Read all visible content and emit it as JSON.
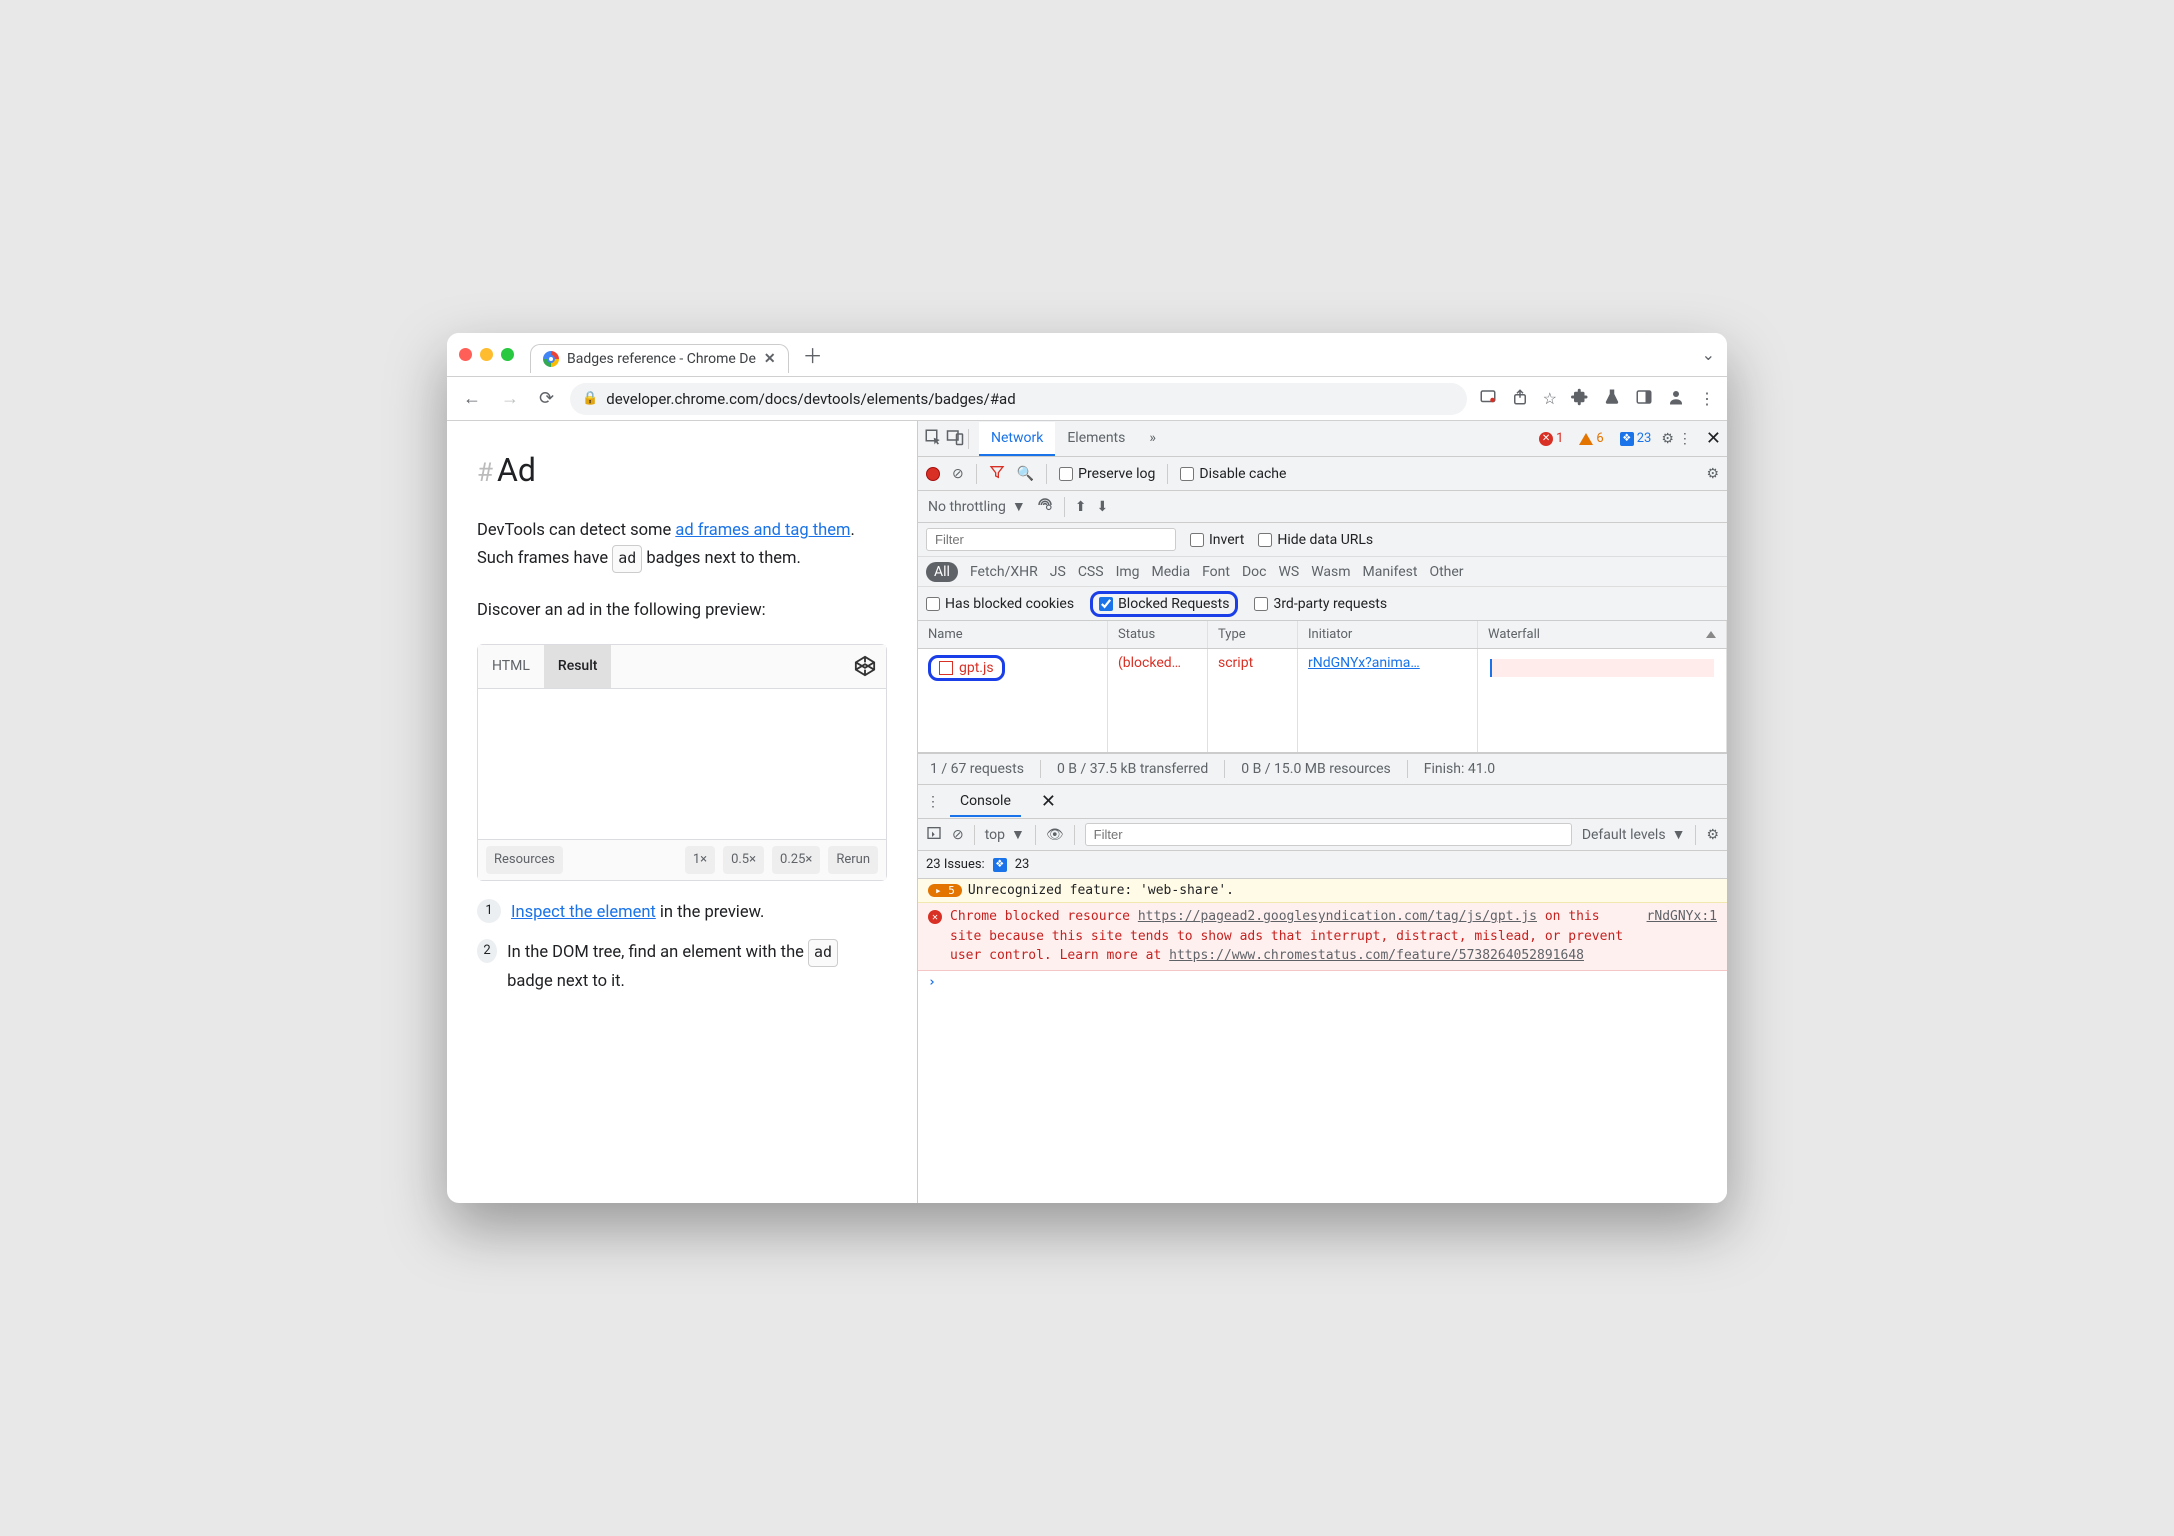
{
  "window": {
    "tab_title": "Badges reference - Chrome De",
    "url": "developer.chrome.com/docs/devtools/elements/badges/#ad"
  },
  "page": {
    "heading": "Ad",
    "intro_prefix": "DevTools can detect some ",
    "intro_link": "ad frames and tag them",
    "intro_suffix": ". Such frames have ",
    "intro_badge": "ad",
    "intro_end": " badges next to them.",
    "discover": "Discover an ad in the following preview:",
    "preview": {
      "tab_html": "HTML",
      "tab_result": "Result",
      "footer_resources": "Resources",
      "footer_1x": "1×",
      "footer_05x": "0.5×",
      "footer_025x": "0.25×",
      "footer_rerun": "Rerun"
    },
    "step1_link": "Inspect the element",
    "step1_rest": " in the preview.",
    "step2_prefix": "In the DOM tree, find an element with the ",
    "step2_badge": "ad",
    "step2_suffix": " badge next to it."
  },
  "devtools": {
    "tabs": {
      "network": "Network",
      "elements": "Elements"
    },
    "counts": {
      "errors": "1",
      "warnings": "6",
      "issues": "23"
    },
    "toolbar": {
      "preserve_log": "Preserve log",
      "disable_cache": "Disable cache",
      "no_throttling": "No throttling"
    },
    "filter": {
      "placeholder": "Filter",
      "invert": "Invert",
      "hide_urls": "Hide data URLs",
      "types": [
        "All",
        "Fetch/XHR",
        "JS",
        "CSS",
        "Img",
        "Media",
        "Font",
        "Doc",
        "WS",
        "Wasm",
        "Manifest",
        "Other"
      ],
      "has_blocked_cookies": "Has blocked cookies",
      "blocked_requests": "Blocked Requests",
      "third_party": "3rd-party requests"
    },
    "table": {
      "headers": {
        "name": "Name",
        "status": "Status",
        "type": "Type",
        "initiator": "Initiator",
        "waterfall": "Waterfall"
      },
      "row": {
        "name": "gpt.js",
        "status": "(blocked…",
        "type": "script",
        "initiator": "rNdGNYx?anima…"
      }
    },
    "status": {
      "requests": "1 / 67 requests",
      "transferred": "0 B / 37.5 kB transferred",
      "resources": "0 B / 15.0 MB resources",
      "finish": "Finish: 41.0"
    },
    "console": {
      "tab": "Console",
      "context": "top",
      "filter_placeholder": "Filter",
      "levels": "Default levels",
      "issues_label": "23 Issues:",
      "issues_count": "23",
      "warn_count": "5",
      "warn_text": "Unrecognized feature: 'web-share'.",
      "err_prefix": "Chrome blocked resource ",
      "err_url1": "https://pagead2.googlesyndication.com/tag/js/gpt.js",
      "err_mid": " on this site because this site tends to show ads that interrupt, distract, mislead, or prevent user control. Learn more at ",
      "err_url2": "https://www.chromestatus.com/feature/5738264052891648",
      "err_source": "rNdGNYx:1"
    }
  }
}
